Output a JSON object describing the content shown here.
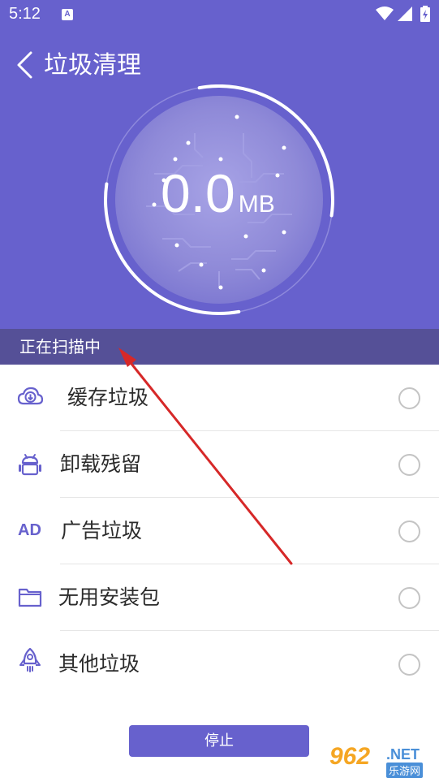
{
  "status_bar": {
    "time": "5:12",
    "notification_letter": "A"
  },
  "header": {
    "title": "垃圾清理"
  },
  "scan": {
    "size_value": "0.0",
    "size_unit": "MB",
    "progress": 0.6,
    "status_text": "正在扫描中"
  },
  "categories": [
    {
      "icon": "cloud-download-icon",
      "label": "缓存垃圾"
    },
    {
      "icon": "android-icon",
      "label": "卸载残留"
    },
    {
      "icon": "ad-icon",
      "label": "广告垃圾",
      "icon_text": "AD"
    },
    {
      "icon": "folder-icon",
      "label": "无用安装包"
    },
    {
      "icon": "rocket-icon",
      "label": "其他垃圾"
    }
  ],
  "actions": {
    "stop_label": "停止"
  },
  "watermark": {
    "number": "962",
    "domain": ".NET",
    "site_name": "乐游网"
  },
  "colors": {
    "primary": "#6761cd",
    "scan_bar": "#555097",
    "annotation_arrow": "#d62828"
  }
}
